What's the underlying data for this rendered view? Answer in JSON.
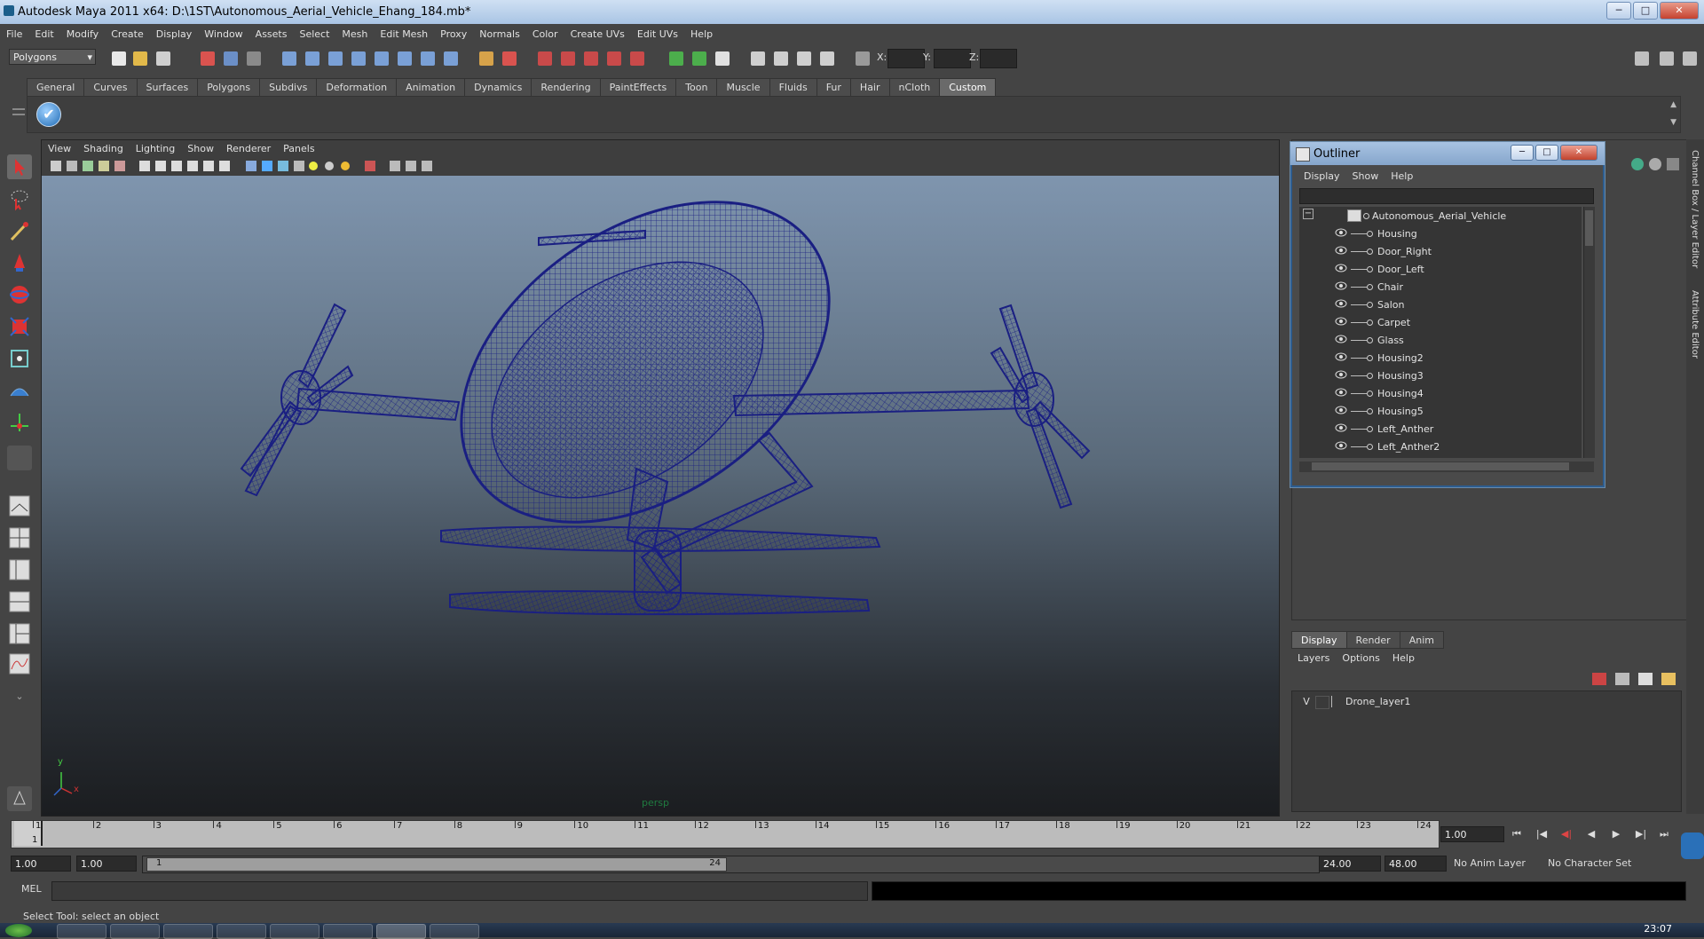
{
  "window": {
    "title": "Autodesk Maya 2011 x64: D:\\1ST\\Autonomous_Aerial_Vehicle_Ehang_184.mb*",
    "minimize": "─",
    "maximize": "□",
    "close": "✕"
  },
  "menubar": [
    "File",
    "Edit",
    "Modify",
    "Create",
    "Display",
    "Window",
    "Assets",
    "Select",
    "Mesh",
    "Edit Mesh",
    "Proxy",
    "Normals",
    "Color",
    "Create UVs",
    "Edit UVs",
    "Help"
  ],
  "statusline": {
    "mode": "Polygons",
    "x_label": "X:",
    "y_label": "Y:",
    "z_label": "Z:"
  },
  "shelf": {
    "tabs": [
      "General",
      "Curves",
      "Surfaces",
      "Polygons",
      "Subdivs",
      "Deformation",
      "Animation",
      "Dynamics",
      "Rendering",
      "PaintEffects",
      "Toon",
      "Muscle",
      "Fluids",
      "Fur",
      "Hair",
      "nCloth",
      "Custom"
    ],
    "active_tab": "Custom",
    "check_icon": "✔"
  },
  "viewport": {
    "menu": [
      "View",
      "Shading",
      "Lighting",
      "Show",
      "Renderer",
      "Panels"
    ],
    "camera": "persp",
    "axis_y": "y",
    "axis_x": "x",
    "wire_color": "#1a1f82"
  },
  "outliner": {
    "title": "Outliner",
    "menu": [
      "Display",
      "Show",
      "Help"
    ],
    "root": "Autonomous_Aerial_Vehicle",
    "items": [
      "Housing",
      "Door_Right",
      "Door_Left",
      "Chair",
      "Salon",
      "Carpet",
      "Glass",
      "Housing2",
      "Housing3",
      "Housing4",
      "Housing5",
      "Left_Anther",
      "Left_Anther2"
    ],
    "collapse": "−"
  },
  "side_tabs": {
    "channel_box": "Channel Box / Layer Editor",
    "attribute_editor": "Attribute Editor"
  },
  "layer_editor": {
    "tabs": [
      "Display",
      "Render",
      "Anim"
    ],
    "active_tab": "Display",
    "menu": [
      "Layers",
      "Options",
      "Help"
    ],
    "layer_visible": "V",
    "layer_name": "Drone_layer1"
  },
  "timeslider": {
    "frames": [
      "1",
      "2",
      "3",
      "4",
      "5",
      "6",
      "7",
      "8",
      "9",
      "10",
      "11",
      "12",
      "13",
      "14",
      "15",
      "16",
      "17",
      "18",
      "19",
      "20",
      "21",
      "22",
      "23",
      "24"
    ],
    "current_marker": "1",
    "current_frame": "1.00"
  },
  "playback_buttons": [
    "⏮",
    "|◀",
    "◀|",
    "◀",
    "▶",
    "▶|",
    "⏭"
  ],
  "range": {
    "start": "1.00",
    "inner_start": "1.00",
    "handle_start": "1",
    "handle_end": "24",
    "end": "24.00",
    "outer_end": "48.00",
    "anim_layer": "No Anim Layer",
    "char_set": "No Character Set"
  },
  "command_line": {
    "label": "MEL"
  },
  "help_line": "Select Tool: select an object",
  "clock": "23:07"
}
